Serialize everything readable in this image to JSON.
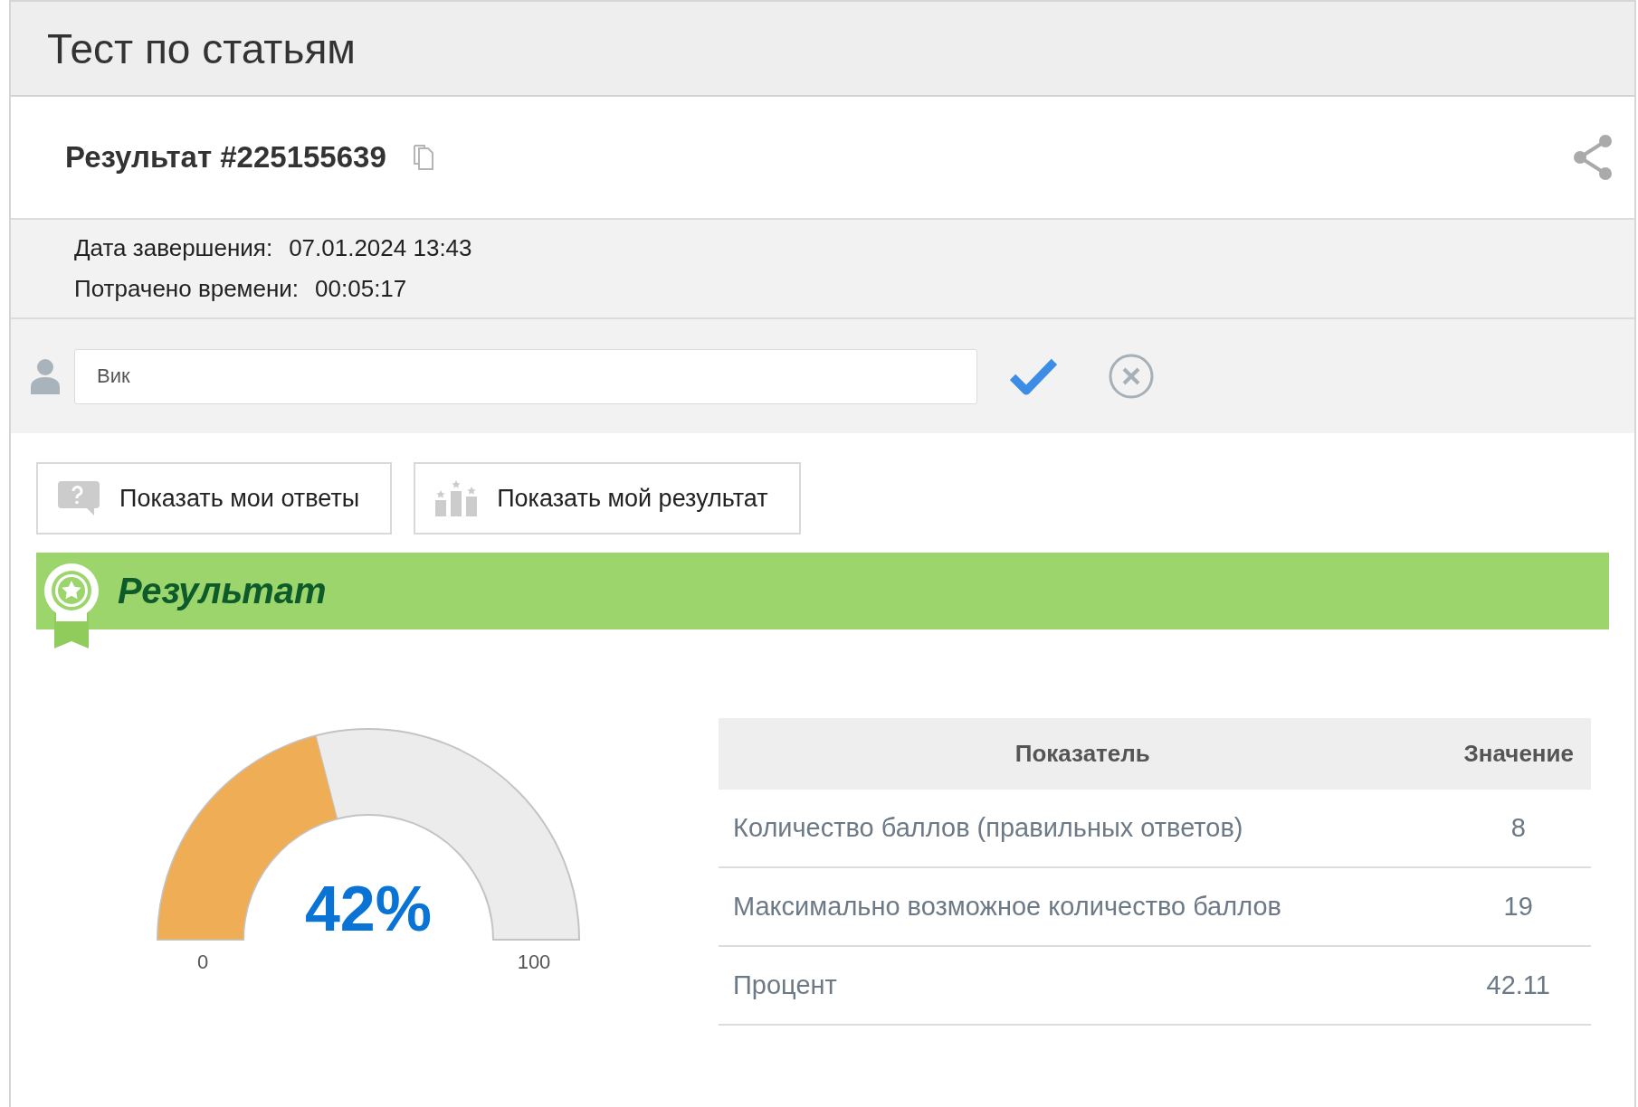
{
  "page": {
    "title": "Тест по статьям"
  },
  "result": {
    "title": "Результат #225155639",
    "info": [
      {
        "label": "Дата завершения:",
        "value": "07.01.2024 13:43"
      },
      {
        "label": "Потрачено времени:",
        "value": "00:05:17"
      }
    ]
  },
  "name_field": {
    "value": "Вик"
  },
  "buttons": [
    {
      "kind": "answers",
      "label": "Показать мои ответы"
    },
    {
      "kind": "result",
      "label": "Показать мой результат"
    }
  ],
  "result_banner": {
    "title": "Результат"
  },
  "gauge": {
    "level": 0.42,
    "value_label": "42%",
    "min_label": "0",
    "max_label": "100"
  },
  "table": {
    "columns": [
      "Показатель",
      "Значение"
    ],
    "rows": [
      {
        "cells": [
          "Количество баллов (правильных ответов)",
          "8"
        ]
      },
      {
        "cells": [
          "Максимально возможное количество баллов",
          "19"
        ]
      },
      {
        "cells": [
          "Процент",
          "42.11"
        ]
      }
    ]
  }
}
